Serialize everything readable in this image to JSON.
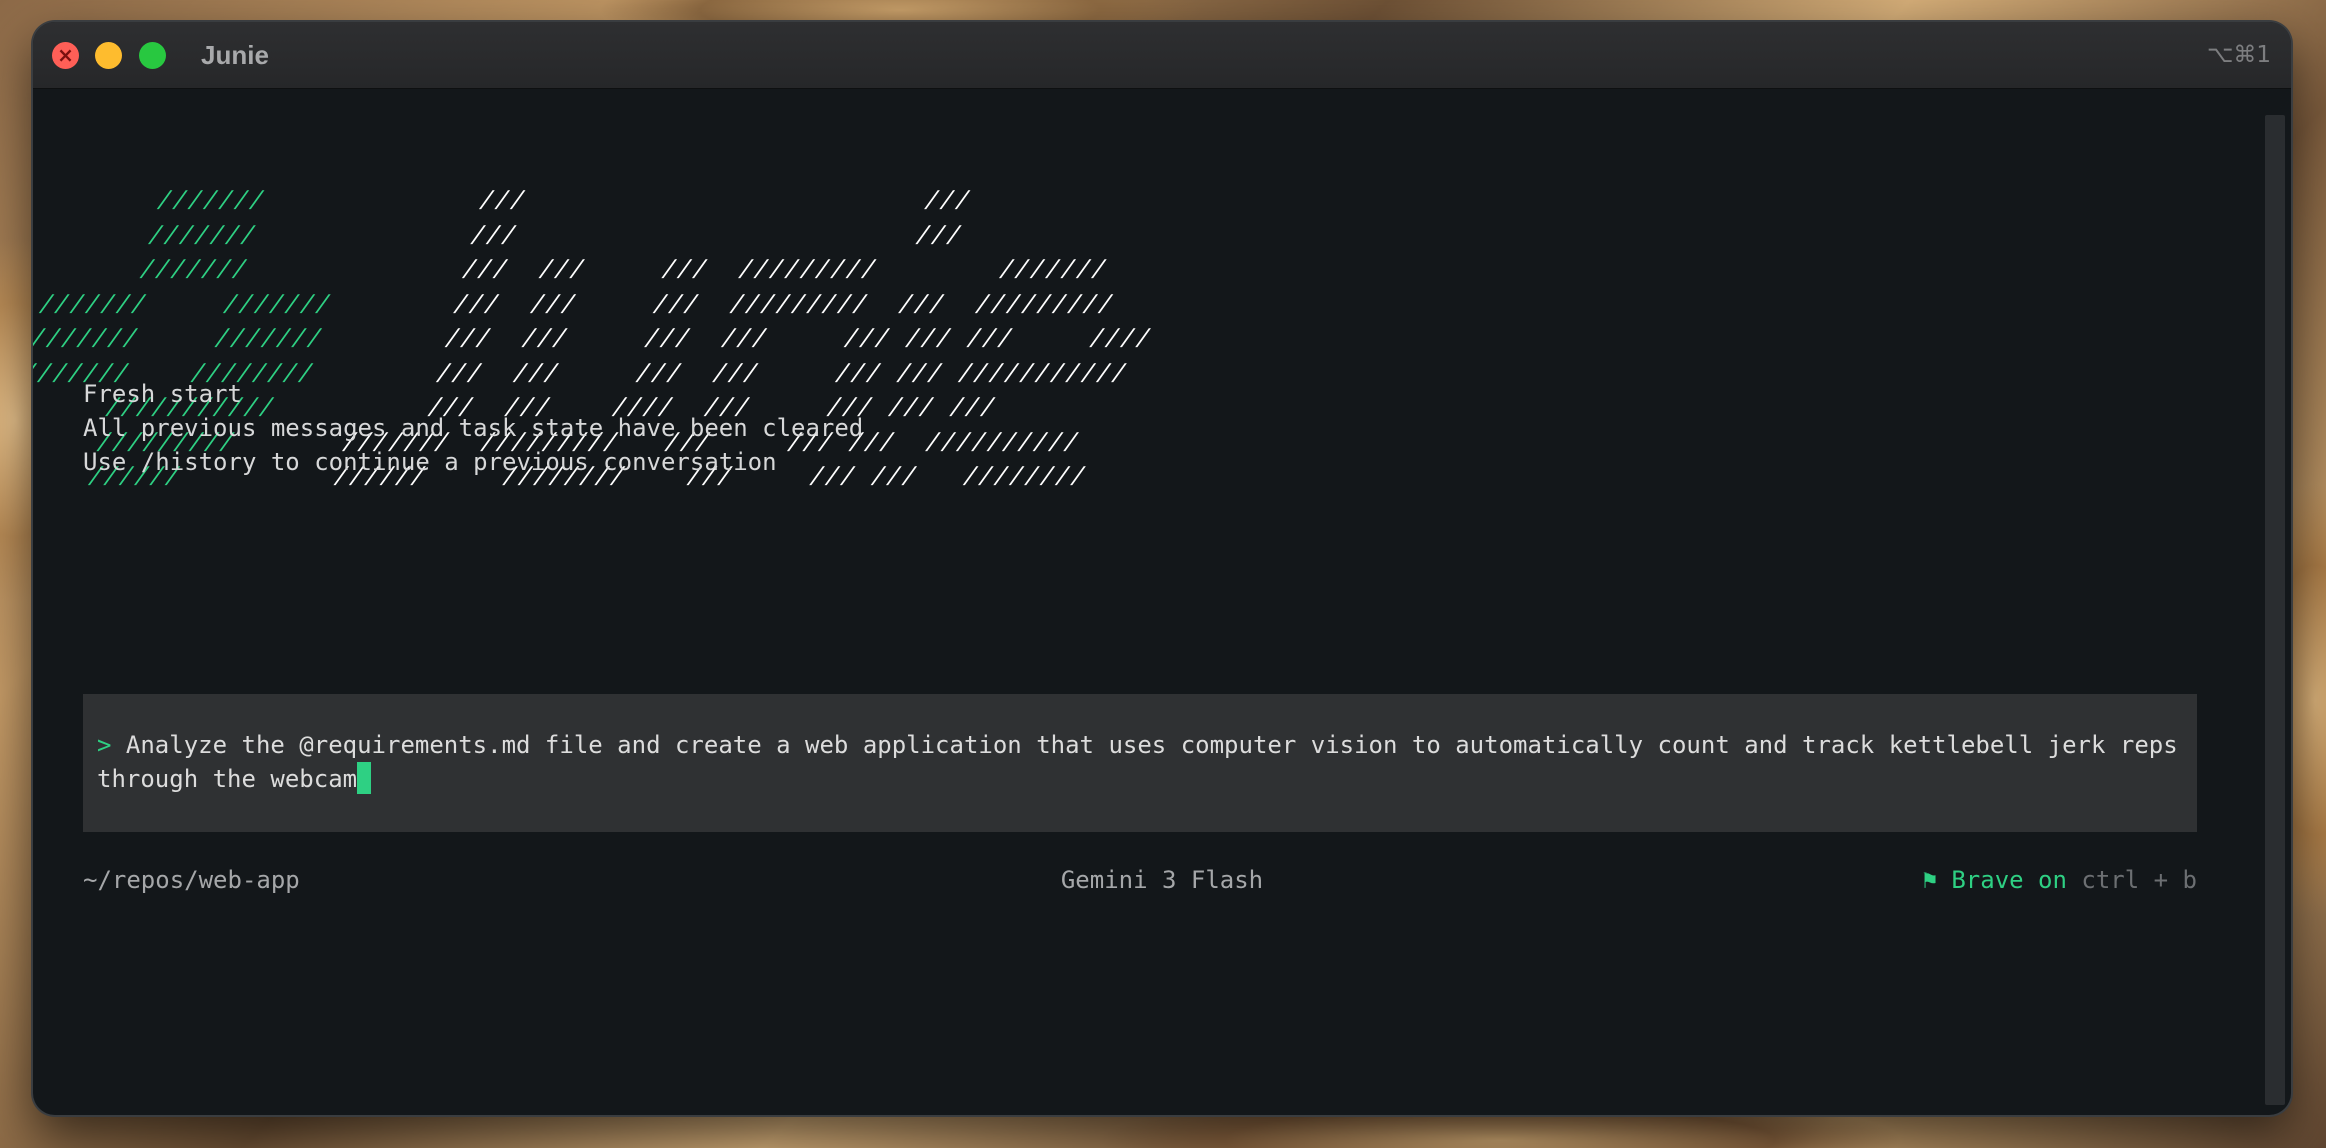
{
  "window": {
    "title": "Junie",
    "shortcut": "⌥⌘1"
  },
  "logo": {
    "lines": [
      [
        {
          "c": "g",
          "t": "      ///////"
        },
        {
          "c": "w",
          "t": "              ///                          ///"
        }
      ],
      [
        {
          "c": "g",
          "t": "      ///////"
        },
        {
          "c": "w",
          "t": "              ///                          ///"
        }
      ],
      [
        {
          "c": "g",
          "t": "      ///////"
        },
        {
          "c": "w",
          "t": "              ///  ///     ///  /////////        ///////"
        }
      ],
      [
        {
          "c": "g",
          "t": "///////     ///////"
        },
        {
          "c": "w",
          "t": "        ///  ///     ///  /////////  ///  /////////"
        }
      ],
      [
        {
          "c": "g",
          "t": "///////     ///////"
        },
        {
          "c": "w",
          "t": "        ///  ///     ///  ///     /// /// ///     ////"
        }
      ],
      [
        {
          "c": "g",
          "t": "///////    ////////"
        },
        {
          "c": "w",
          "t": "        ///  ///     ///  ///     /// /// ///////////"
        }
      ],
      [
        {
          "c": "g",
          "t": "      ///////////"
        },
        {
          "c": "w",
          "t": "          ///  ///    ////  ///     /// /// ///"
        }
      ],
      [
        {
          "c": "g",
          "t": "      /////////"
        },
        {
          "c": "w",
          "t": "       ///////  /////////   ///     /// ///  //////////"
        }
      ],
      [
        {
          "c": "g",
          "t": "      //////"
        },
        {
          "c": "w",
          "t": "          //////     ////////    ///     /// ///   ////////"
        }
      ]
    ]
  },
  "messages": {
    "line1": "Fresh start",
    "line2": "All previous messages and task state have been cleared",
    "line3": "Use /history to continue a previous conversation"
  },
  "prompt": {
    "marker": ">",
    "text": " Analyze the @requirements.md file and create a web application that uses computer vision to automatically count and track kettlebell jerk reps through the webcam"
  },
  "status": {
    "path": "~/repos/web-app",
    "model": "Gemini 3 Flash",
    "brave": "⚑ Brave on",
    "hint": " ctrl + b"
  },
  "colors": {
    "accent": "#2ed083",
    "background": "#13171a",
    "prompt_bg": "#2f3133"
  }
}
